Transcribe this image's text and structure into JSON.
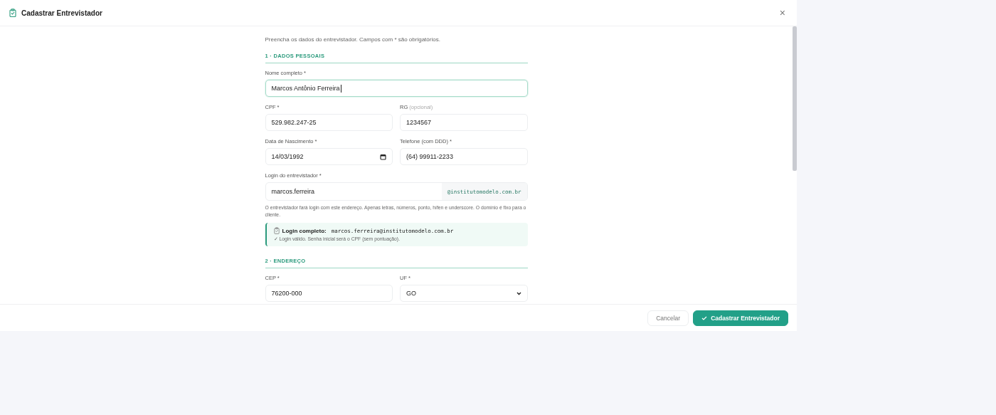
{
  "dialog": {
    "title": "Cadastrar Entrevistador",
    "close": "×",
    "intro": "Preencha os dados do entrevistador. Campos com * são obrigatórios.",
    "sections": [
      {
        "title": "1 · DADOS PESSOAIS",
        "items": [
          {
            "kind": "field",
            "fields": [
              {
                "kind": "text",
                "label": "Nome completo *",
                "value": "Marcos Antônio Ferreira",
                "focused": true
              }
            ]
          },
          {
            "kind": "field",
            "fields": [
              {
                "kind": "text",
                "label": "CPF *",
                "value": "529.982.247-25",
                "focused": false
              },
              {
                "kind": "text",
                "label": "RG",
                "label_note": "(opcional)",
                "value": "1234567",
                "focused": false
              }
            ]
          },
          {
            "kind": "field",
            "fields": [
              {
                "kind": "date",
                "label": "Data de Nascimento *",
                "value": "14/03/1992",
                "focused": false
              },
              {
                "kind": "text",
                "label": "Telefone (com DDD) *",
                "value": "(64) 99911-2233",
                "focused": false
              }
            ]
          },
          {
            "kind": "login",
            "label": "Login do entrevistador *",
            "value": "marcos.ferreira",
            "suffix": "@institutomodelo.com.br"
          },
          {
            "kind": "help",
            "text": "O entrevistador fará login com este endereço. Apenas letras, números, ponto, hífen e underscore. O domínio é fixo para o cliente."
          },
          {
            "kind": "info",
            "title": "Login completo:",
            "value": "marcos.ferreira@institutomodelo.com.br",
            "note": "✓ Login válido. Senha inicial será o CPF (sem pontuação)."
          }
        ]
      },
      {
        "title": "2 · ENDEREÇO",
        "items": [
          {
            "kind": "field",
            "fields": [
              {
                "kind": "text",
                "label": "CEP *",
                "value": "76200-000",
                "focused": false
              },
              {
                "kind": "select",
                "label": "UF *",
                "value": "GO",
                "focused": false
              }
            ]
          }
        ]
      }
    ],
    "buttons": [
      {
        "kind": "secondary",
        "label": "Cancelar"
      },
      {
        "kind": "primary",
        "label": "Cadastrar Entrevistador"
      }
    ]
  }
}
